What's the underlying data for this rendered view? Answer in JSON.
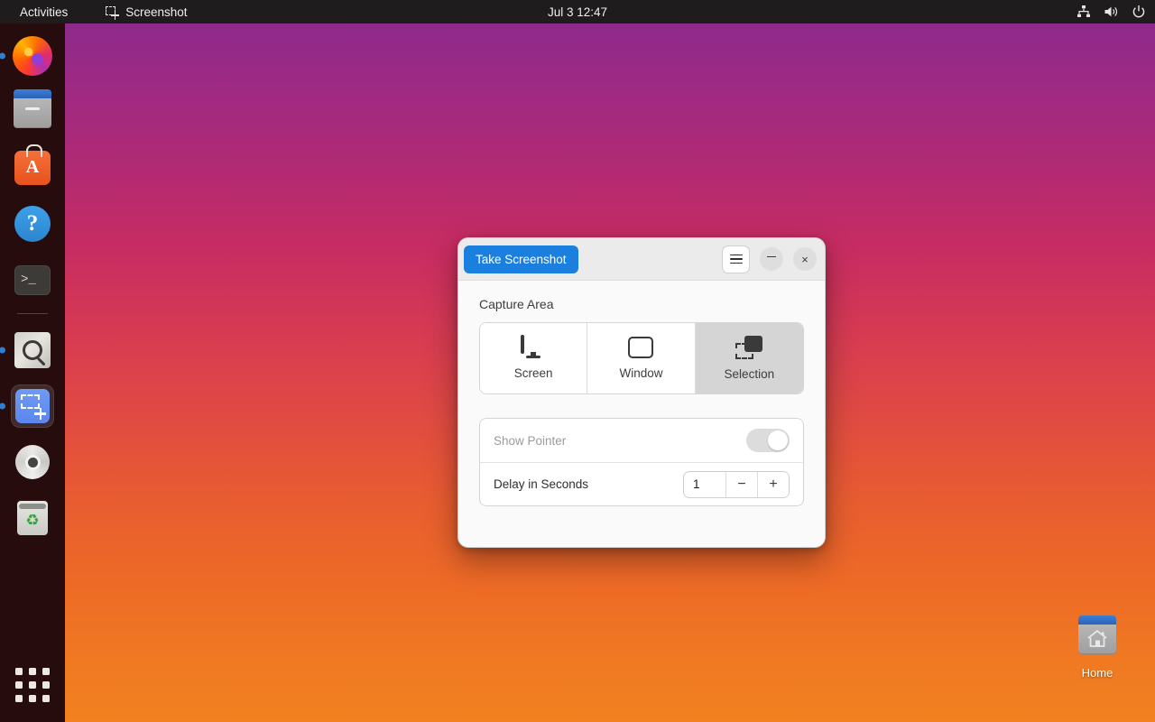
{
  "topbar": {
    "activities": "Activities",
    "app_name": "Screenshot",
    "app_icon": "selection-plus-icon",
    "clock": "Jul 3  12:47",
    "tray": [
      {
        "name": "network-icon"
      },
      {
        "name": "volume-icon"
      },
      {
        "name": "power-icon"
      }
    ]
  },
  "dock": {
    "items": [
      {
        "name": "firefox",
        "label": "Firefox",
        "running": true,
        "active": false
      },
      {
        "name": "files",
        "label": "Files",
        "running": false,
        "active": false
      },
      {
        "name": "software",
        "label": "Ubuntu Software",
        "running": false,
        "active": false,
        "glyph": "A"
      },
      {
        "name": "help",
        "label": "Help",
        "running": false,
        "active": false,
        "glyph": "?"
      },
      {
        "name": "terminal",
        "label": "Terminal",
        "running": false,
        "active": false,
        "glyph": ">_"
      },
      {
        "name": "magnifier",
        "label": "Magnifier",
        "running": true,
        "active": false
      },
      {
        "name": "screenshot",
        "label": "Screenshot",
        "running": true,
        "active": true
      },
      {
        "name": "disc",
        "label": "Disc",
        "running": false,
        "active": false
      },
      {
        "name": "trash",
        "label": "Trash",
        "running": false,
        "active": false
      }
    ],
    "apps_grid": "show-applications"
  },
  "desktop": {
    "icons": [
      {
        "name": "home-folder",
        "label": "Home"
      }
    ]
  },
  "dialog": {
    "titlebar": {
      "take_screenshot": "Take Screenshot",
      "menu_icon": "hamburger-menu-icon",
      "minimize_icon": "minimize-icon",
      "close_icon": "close-icon",
      "close_glyph": "×"
    },
    "capture_area": {
      "label": "Capture Area",
      "options": [
        {
          "id": "screen",
          "label": "Screen",
          "icon": "monitor-icon",
          "selected": false
        },
        {
          "id": "window",
          "label": "Window",
          "icon": "window-icon",
          "selected": false
        },
        {
          "id": "selection",
          "label": "Selection",
          "icon": "selection-icon",
          "selected": true
        }
      ]
    },
    "options": {
      "show_pointer": {
        "label": "Show Pointer",
        "enabled": false,
        "value": false
      },
      "delay": {
        "label": "Delay in Seconds",
        "value": "1",
        "decrement_glyph": "−",
        "increment_glyph": "+"
      }
    }
  },
  "colors": {
    "accent": "#1b7fe0",
    "titlebar_bg": "#ebebeb",
    "window_bg": "#fafafa",
    "selected_bg": "#d5d5d5",
    "topbar_bg": "#1e1c1c"
  }
}
